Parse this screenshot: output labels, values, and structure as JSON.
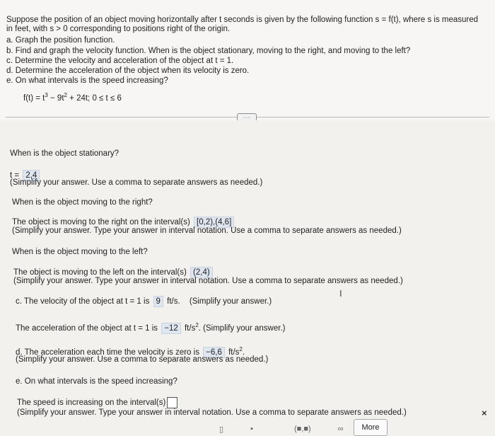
{
  "problem": {
    "intro_line1": "Suppose the position of an object moving horizontally after t seconds is given by the following function s = f(t), where s is measured",
    "intro_line2": "in feet, with s > 0 corresponding to positions right of the origin.",
    "parts": [
      "a. Graph the position function.",
      "b. Find and graph the velocity function. When is the object stationary, moving to the right, and moving to the left?",
      "c. Determine the velocity and acceleration of the object at t = 1.",
      "d. Determine the acceleration of the object when its velocity is zero.",
      "e. On what intervals is the speed increasing?"
    ],
    "function_a": "f(t) = t",
    "function_b": " − 9t",
    "function_c": " + 24t; 0 ≤ t ≤ 6",
    "exp3": "3",
    "exp2": "2"
  },
  "stationary": {
    "question": "When is the object stationary?",
    "prefix": "t =",
    "answer": "2,4",
    "hint": "(Simplify your answer. Use a comma to separate answers as needed.)"
  },
  "right": {
    "question": "When is the object moving to the right?",
    "prefix": "The object is moving to the right on the interval(s)",
    "answer": "[0,2),(4,6]",
    "hint": "(Simplify your answer. Type your answer in interval notation. Use a comma to separate answers as needed.)"
  },
  "left": {
    "question": "When is the object moving to the left?",
    "prefix": "The object is moving to the left on the interval(s)",
    "answer": "(2,4)",
    "hint": "(Simplify your answer. Type your answer in interval notation. Use a comma to separate answers as needed.)"
  },
  "velocity": {
    "prefix": "c. The velocity of the object at t = 1 is",
    "answer": "9",
    "unit": "ft/s.",
    "hint": "(Simplify your answer.)"
  },
  "acceleration": {
    "prefix": "The acceleration of the object at t = 1 is",
    "answer": "−12",
    "unit": "ft/s",
    "unit_exp": "2",
    "hint": ". (Simplify your answer.)"
  },
  "part_d": {
    "prefix": "d. The acceleration each time the velocity is zero is",
    "answer": "−6,6",
    "unit": "ft/s",
    "unit_exp": "2",
    "period": ".",
    "hint": "(Simplify your answer. Use a comma to separate answers as needed.)"
  },
  "part_e": {
    "question": "e. On what intervals is the speed increasing?",
    "prefix": "The speed is increasing on the interval(s)",
    "hint": "(Simplify your answer. Type your answer in interval notation. Use a comma to separate answers as needed.)"
  },
  "toolbar": {
    "more_label": "More",
    "infinity": "∞",
    "interval_tool": "(■,■)",
    "close": "×"
  },
  "cursor_glyph": "I",
  "more_handle": "·····"
}
